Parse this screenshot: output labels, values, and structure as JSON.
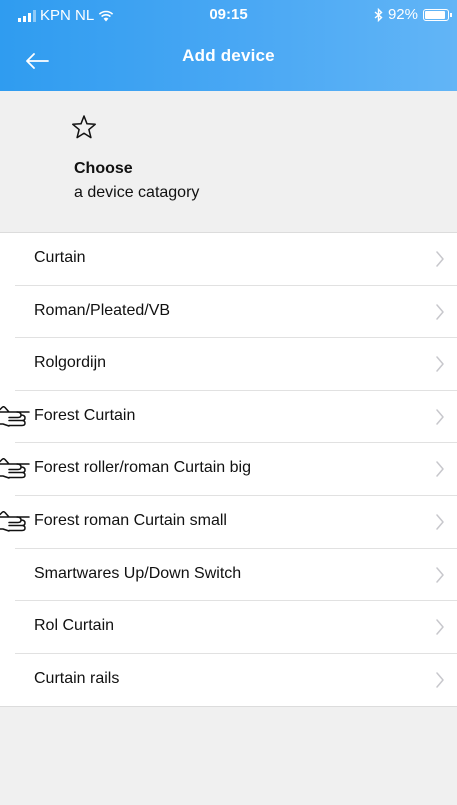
{
  "status": {
    "carrier": "KPN NL",
    "time": "09:15",
    "battery": "92%",
    "battery_level": 0.92
  },
  "nav": {
    "title": "Add device"
  },
  "category": {
    "title": "Choose",
    "subtitle": "a device catagory"
  },
  "items": [
    {
      "label": "Curtain",
      "pointer": false
    },
    {
      "label": "Roman/Pleated/VB",
      "pointer": false
    },
    {
      "label": "Rolgordijn",
      "pointer": false
    },
    {
      "label": "Forest Curtain",
      "pointer": true
    },
    {
      "label": "Forest roller/roman Curtain big",
      "pointer": true
    },
    {
      "label": "Forest roman Curtain small",
      "pointer": true
    },
    {
      "label": "Smartwares Up/Down Switch",
      "pointer": false
    },
    {
      "label": "Rol Curtain",
      "pointer": false
    },
    {
      "label": "Curtain rails",
      "pointer": false
    }
  ],
  "colors": {
    "header": "#3aa1f2",
    "background": "#f0f0f0",
    "chevron": "#c7c7cc"
  }
}
